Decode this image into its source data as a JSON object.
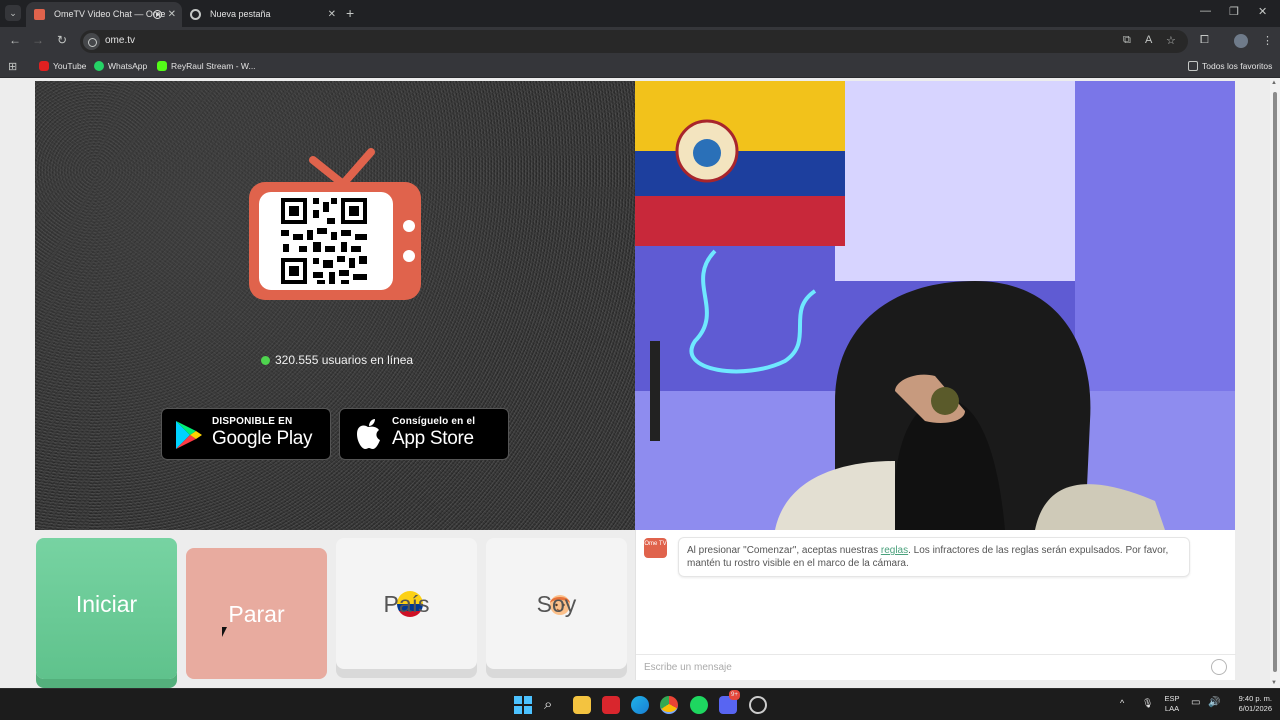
{
  "browser": {
    "tabs": [
      {
        "label": "OmeTV Video Chat — Ome",
        "active": true
      },
      {
        "label": "Nueva pestaña",
        "active": false
      }
    ],
    "url": "ome.tv",
    "bookmarks": [
      "YouTube",
      "WhatsApp",
      "ReyRaul Stream - W..."
    ],
    "all_bookmarks": "Todos los favoritos"
  },
  "page": {
    "online_text": "320.555 usuarios en línea",
    "google_play": {
      "small": "DISPONIBLE EN",
      "big": "Google Play"
    },
    "app_store": {
      "small": "Consíguelo en el",
      "big": "App Store"
    },
    "buttons": {
      "start": "Iniciar",
      "stop": "Parar",
      "country": "País",
      "me": "Soy"
    },
    "chat": {
      "logo_text": "Ome TV",
      "message_before_link": "Al presionar \"Comenzar\", aceptas nuestras ",
      "message_link": "reglas",
      "message_after_link": ". Los infractores de las reglas serán expulsados. Por favor, mantén tu rostro visible en el marco de la cámara.",
      "input_placeholder": "Escribe un mensaje"
    }
  },
  "taskbar": {
    "lang_top": "ESP",
    "lang_bottom": "LAA",
    "time": "9:40 p. m.",
    "date": "6/01/2026",
    "discord_badge": "9+"
  },
  "colors": {
    "start": "#6ccb98",
    "stop": "#e8ab9f",
    "tv": "#e0634c",
    "online_dot": "#4ed44e"
  }
}
